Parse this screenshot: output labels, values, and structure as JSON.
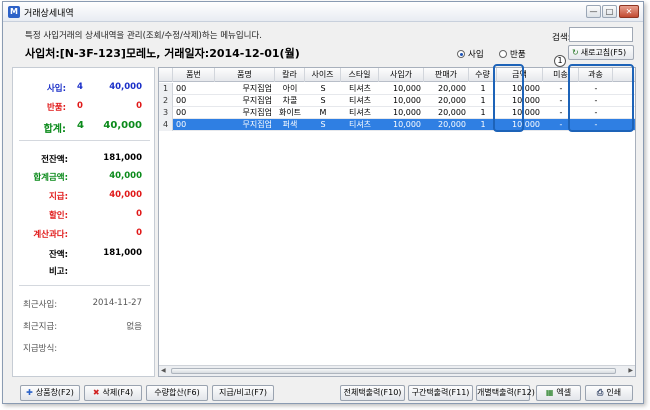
{
  "window": {
    "app_icon": "M",
    "title": "거래상세내역",
    "min": "—",
    "max": "□",
    "close": "✕"
  },
  "description": "특정 사입거래의 상세내역을 관리(조회/수정/삭제)하는 메뉴입니다.",
  "search": {
    "label": "검색:",
    "value": ""
  },
  "refresh_button": "새로고침(F5)",
  "header_text": "사입처:[N-3F-123]모레노, 거래일자:2014-12-01(월)",
  "mode_radio": {
    "options": [
      "사입",
      "반품"
    ],
    "selected": "사입"
  },
  "summary": {
    "purchase": {
      "label": "사입:",
      "count": "4",
      "amount": "40,000"
    },
    "return": {
      "label": "반품:",
      "count": "0",
      "amount": "0"
    },
    "total": {
      "label": "합계:",
      "count": "4",
      "amount": "40,000"
    }
  },
  "balances": [
    {
      "label": "전잔액:",
      "value": "181,000",
      "color": "black"
    },
    {
      "label": "합계금액:",
      "value": "40,000",
      "color": "green"
    },
    {
      "label": "지급:",
      "value": "40,000",
      "color": "red"
    },
    {
      "label": "할인:",
      "value": "0",
      "color": "red"
    },
    {
      "label": "계산과다:",
      "value": "0",
      "color": "red"
    },
    {
      "label": "잔액:",
      "value": "181,000",
      "color": "black"
    },
    {
      "label": "비고:",
      "value": "",
      "color": "black"
    }
  ],
  "recent": [
    {
      "label": "최근사입:",
      "value": "2014-11-27"
    },
    {
      "label": "최근지급:",
      "value": "없음"
    },
    {
      "label": "지급방식:",
      "value": ""
    }
  ],
  "grid": {
    "headers": [
      "",
      "품번",
      "품명",
      "칼라",
      "사이즈",
      "스타일",
      "사입가",
      "판매가",
      "수량",
      "금액",
      "미송",
      "과송"
    ],
    "rows": [
      [
        "1",
        "00",
        "무지집업",
        "아이",
        "S",
        "티셔츠",
        "10,000",
        "20,000",
        "1",
        "10,000",
        "-",
        "-"
      ],
      [
        "2",
        "00",
        "무지집업",
        "차콜",
        "S",
        "티셔츠",
        "10,000",
        "20,000",
        "1",
        "10,000",
        "-",
        "-"
      ],
      [
        "3",
        "00",
        "무지집업",
        "화이트",
        "M",
        "티셔츠",
        "10,000",
        "20,000",
        "1",
        "10,000",
        "-",
        "-"
      ],
      [
        "4",
        "00",
        "무지집업",
        "퍼색",
        "S",
        "티셔츠",
        "10,000",
        "20,000",
        "1",
        "10,000",
        "-",
        "-"
      ]
    ],
    "selected_row": 3,
    "callout": "1"
  },
  "buttons": {
    "add_product": "상품창(F2)",
    "delete": "삭제(F4)",
    "qty_sum": "수량합산(F6)",
    "payment": "지급/비고(F7)",
    "print_all": "전체택출력(F10)",
    "print_range": "구간택출력(F11)",
    "print_each": "개별택출력(F12)",
    "excel": "엑셀",
    "print": "인쇄"
  },
  "colors": {
    "selected_row": "#2f7fe3",
    "highlight": "#1d63b8",
    "blue": "#1a2fc8",
    "red": "#e01818",
    "green": "#0a8a1a"
  }
}
